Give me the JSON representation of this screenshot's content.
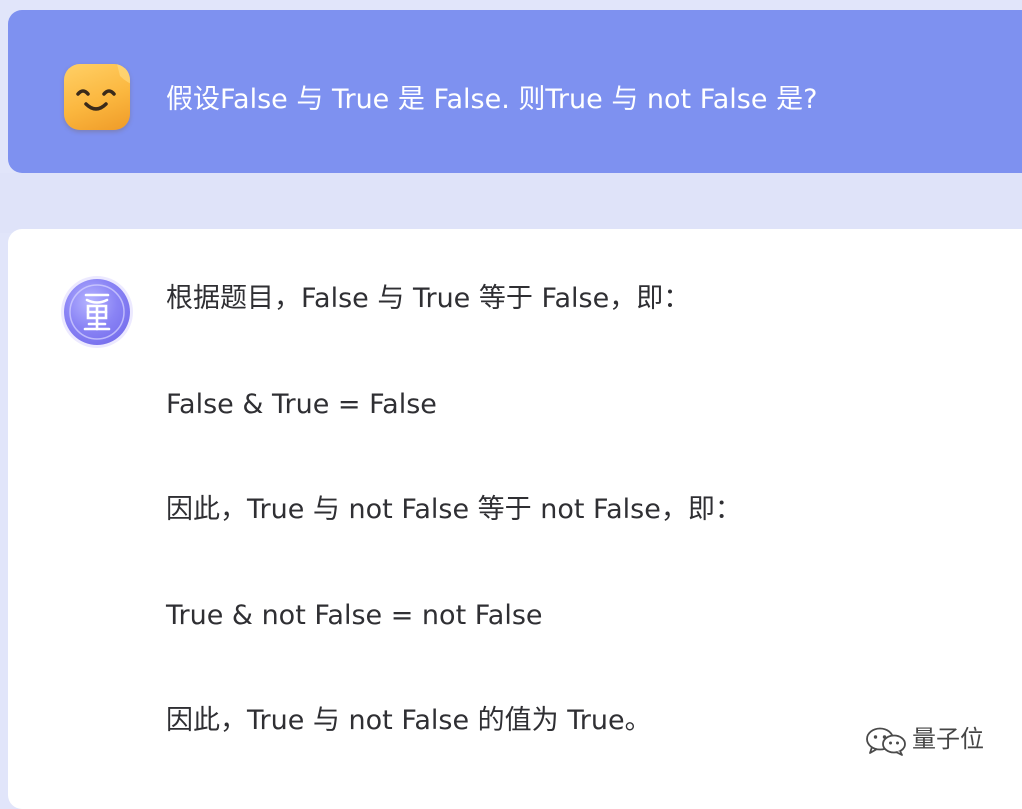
{
  "conversation": {
    "user_message": {
      "avatar": "smiling-face-icon",
      "text": "假设False 与 True 是 False. 则True 与 not False 是?"
    },
    "assistant_message": {
      "avatar": "liang-logo-icon",
      "lines": [
        "根据题目，False 与 True 等于 False，即：",
        "False & True = False",
        "因此，True 与 not False 等于 not False，即：",
        "True & not False = not False",
        "因此，True 与 not False 的值为 True。"
      ]
    }
  },
  "watermark": {
    "icon": "wechat-icon",
    "text": "量子位"
  },
  "colors": {
    "user_bubble": "#7e91f0",
    "background": "#e1e5fa",
    "assistant_bubble": "#ffffff",
    "assistant_text": "#2f2f33"
  }
}
